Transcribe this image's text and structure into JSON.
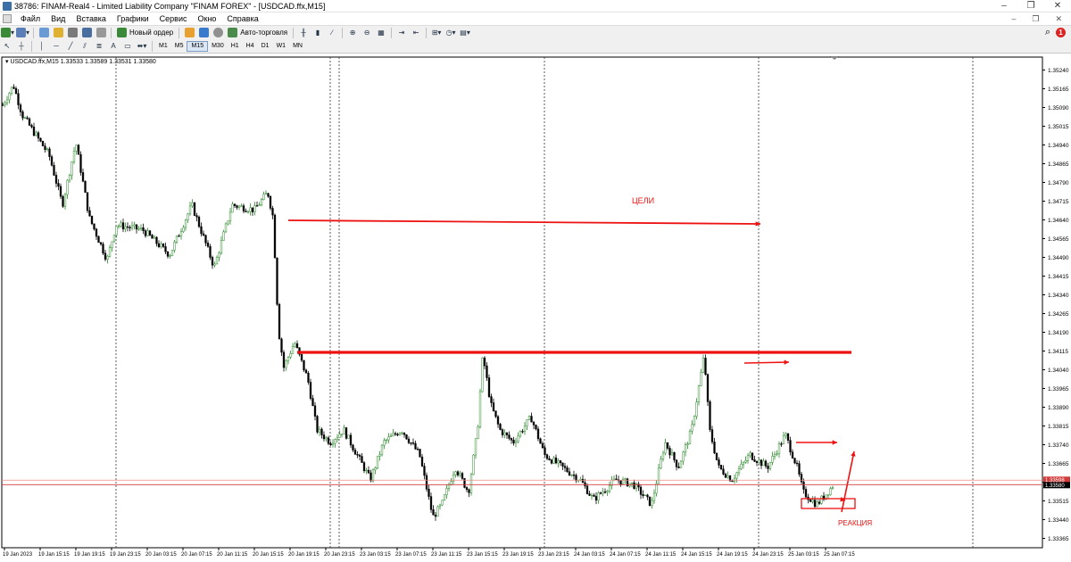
{
  "window": {
    "title": "38786: FINAM-Real4 - Limited Liability Company \"FINAM FOREX\" - [USDCAD.ffx,M15]",
    "minimize": "–",
    "restore": "❐",
    "close": "✕"
  },
  "menu": {
    "items": [
      "Файл",
      "Вид",
      "Вставка",
      "Графики",
      "Сервис",
      "Окно",
      "Справка"
    ]
  },
  "toolbar": {
    "new_order": "Новый ордер",
    "autotrading": "Авто-торговля",
    "timeframes": [
      "M1",
      "M5",
      "M15",
      "M30",
      "H1",
      "H4",
      "D1",
      "W1",
      "MN"
    ],
    "active_timeframe": "M15",
    "alerts_count": "1"
  },
  "chart": {
    "header": "USDCAD.ffx,M15  1.33533 1.33589 1.33531 1.33580",
    "price_labels": [
      "1.35240",
      "1.35165",
      "1.35090",
      "1.35015",
      "1.34940",
      "1.34865",
      "1.34790",
      "1.34715",
      "1.34640",
      "1.34565",
      "1.34490",
      "1.34415",
      "1.34340",
      "1.34265",
      "1.34190",
      "1.34115",
      "1.34040",
      "1.33965",
      "1.33890",
      "1.33815",
      "1.33740",
      "1.33665",
      "1.33590",
      "1.33515",
      "1.33440",
      "1.33365"
    ],
    "current_price_upper": "1.33598",
    "current_price": "1.33580",
    "time_labels": [
      "19 Jan 2023",
      "19 Jan 15:15",
      "19 Jan 19:15",
      "19 Jan 23:15",
      "20 Jan 03:15",
      "20 Jan 07:15",
      "20 Jan 11:15",
      "20 Jan 15:15",
      "20 Jan 19:15",
      "20 Jan 23:15",
      "23 Jan 03:15",
      "23 Jan 07:15",
      "23 Jan 11:15",
      "23 Jan 15:15",
      "23 Jan 19:15",
      "23 Jan 23:15",
      "24 Jan 03:15",
      "24 Jan 07:15",
      "24 Jan 11:15",
      "24 Jan 15:15",
      "24 Jan 19:15",
      "24 Jan 23:15",
      "25 Jan 03:15",
      "25 Jan 07:15"
    ],
    "annotations": {
      "targets": "ЦЕЛИ",
      "reaction": "РЕАКЦИЯ"
    },
    "colors": {
      "bull": "#2e8b2e",
      "bear": "#000000",
      "annotation": "#ee1111",
      "bid_line": "#d33b3b",
      "ask_line": "#ef8a8a"
    }
  }
}
